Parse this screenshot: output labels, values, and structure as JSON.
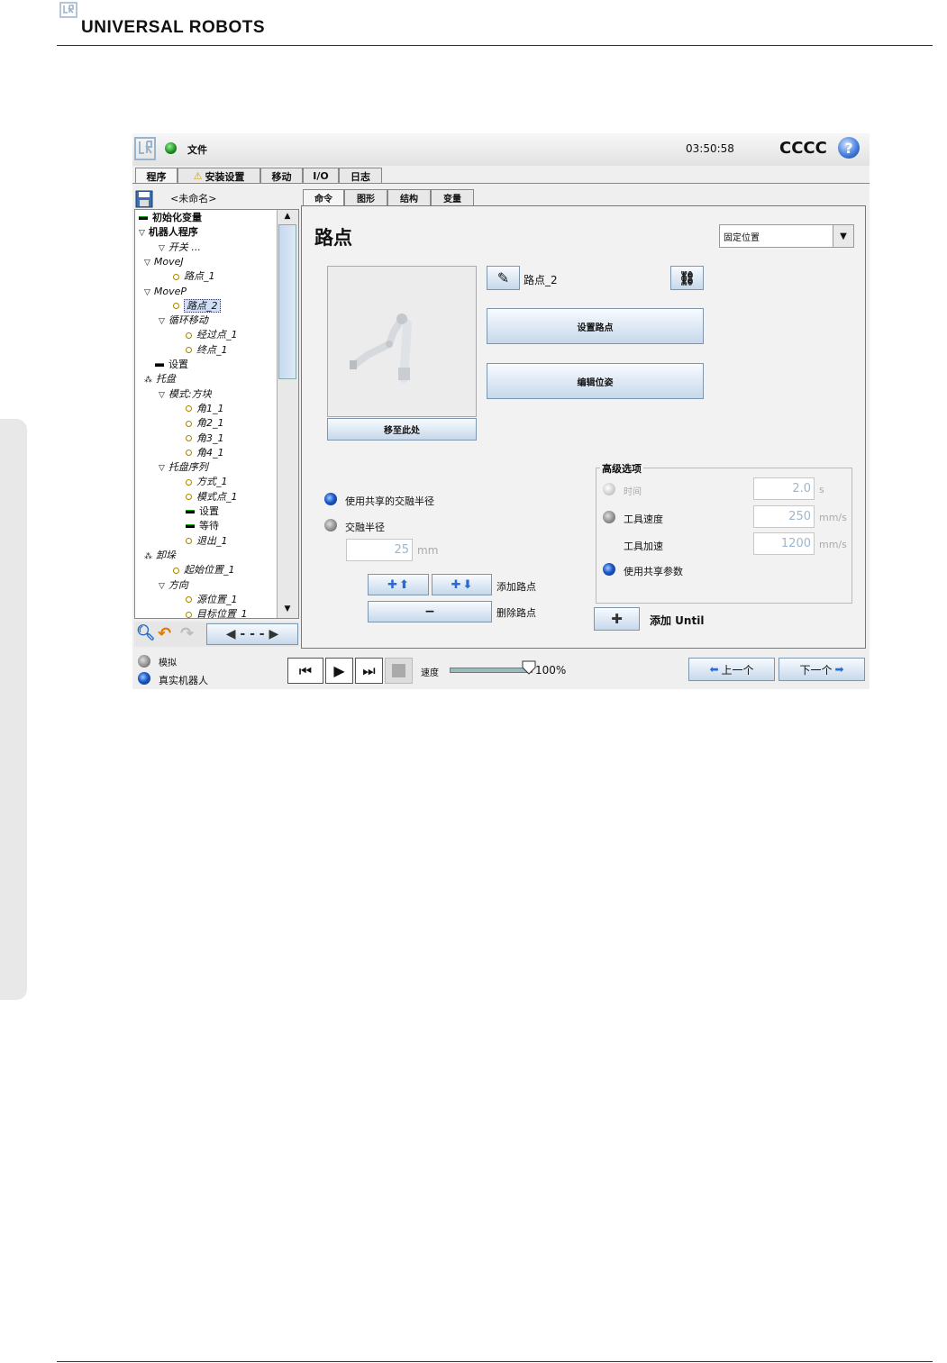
{
  "brand": {
    "name": "UNIVERSAL ROBOTS"
  },
  "topbar": {
    "menu_label": "文件",
    "clock": "03:50:58",
    "robot_name": "CCCC",
    "help_icon": "help-icon"
  },
  "main_tabs": [
    "程序",
    "安装设置",
    "移动",
    "I/O",
    "日志"
  ],
  "file_name": "<未命名>",
  "tree": [
    {
      "label": "初始化变量",
      "type": "bar"
    },
    {
      "label": "机器人程序",
      "type": "triangle"
    },
    {
      "label": "开关 ...",
      "type": "triangle"
    },
    {
      "label": "MoveJ",
      "type": "triangle"
    },
    {
      "label": "路点_1",
      "type": "dot"
    },
    {
      "label": "MoveP",
      "type": "triangle"
    },
    {
      "label": "路点_2",
      "type": "dot",
      "selected": true
    },
    {
      "label": "循环移动",
      "type": "triangle"
    },
    {
      "label": "经过点_1",
      "type": "dot"
    },
    {
      "label": "终点_1",
      "type": "dot"
    },
    {
      "label": "设置",
      "type": "bar"
    },
    {
      "label": "托盘",
      "type": "pallet"
    },
    {
      "label": "模式:方块",
      "type": "triangle"
    },
    {
      "label": "角1_1",
      "type": "dot"
    },
    {
      "label": "角2_1",
      "type": "dot"
    },
    {
      "label": "角3_1",
      "type": "dot"
    },
    {
      "label": "角4_1",
      "type": "dot"
    },
    {
      "label": "托盘序列",
      "type": "triangle"
    },
    {
      "label": "方式_1",
      "type": "dot"
    },
    {
      "label": "模式点_1",
      "type": "dot"
    },
    {
      "label": "设置",
      "type": "bar"
    },
    {
      "label": "等待",
      "type": "bar"
    },
    {
      "label": "退出_1",
      "type": "dot"
    },
    {
      "label": "卸垛",
      "type": "pallet"
    },
    {
      "label": "起始位置_1",
      "type": "dot"
    },
    {
      "label": "方向",
      "type": "triangle"
    },
    {
      "label": "源位置_1",
      "type": "dot"
    },
    {
      "label": "目标位置_1",
      "type": "dot"
    }
  ],
  "sub_tabs": [
    "命令",
    "图形",
    "结构",
    "变量"
  ],
  "panel": {
    "title": "路点",
    "position_select": "固定位置",
    "waypoint_name": "路点_2",
    "set_waypoint_button": "设置路点",
    "edit_pose_button": "编辑位姿",
    "move_here_button": "移至此处",
    "shared_blend_label": "使用共享的交融半径",
    "blend_radius_label": "交融半径",
    "blend_radius_value": "25",
    "blend_radius_unit": "mm",
    "add_waypoint_label": "添加路点",
    "delete_waypoint_label": "删除路点",
    "advanced": {
      "title": "高级选项",
      "time_label": "时间",
      "time_value": "2.0",
      "time_unit": "s",
      "tool_speed_label": "工具速度",
      "tool_speed_value": "250",
      "tool_speed_unit": "mm/s",
      "tool_accel_label": "工具加速",
      "tool_accel_value": "1200",
      "tool_accel_unit": "mm/s",
      "shared_params_label": "使用共享参数"
    },
    "add_until_label": "添加 Until"
  },
  "bottom": {
    "simulate_label": "模拟",
    "real_robot_label": "真实机器人",
    "speed_label": "速度",
    "speed_value": "100%",
    "speed_fraction": 1.0,
    "prev_label": "上一个",
    "next_label": "下一个"
  }
}
